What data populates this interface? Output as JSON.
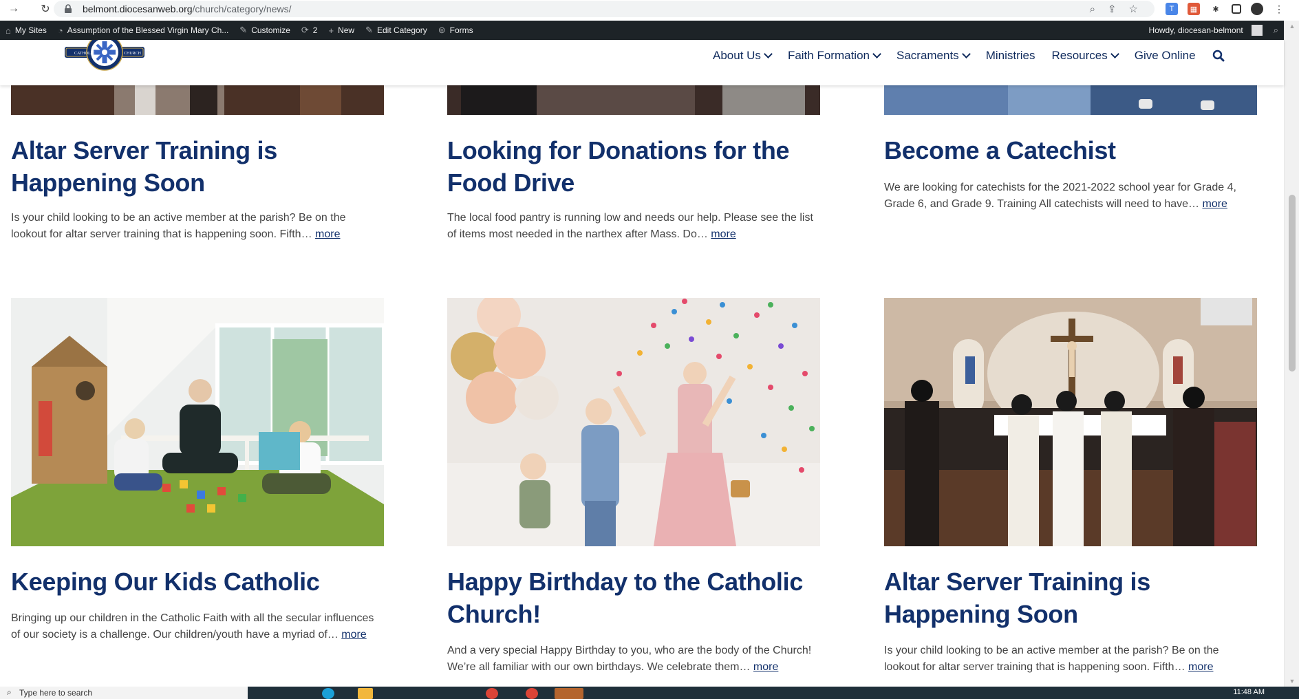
{
  "browser": {
    "url_host": "belmont.diocesanweb.org",
    "url_path": "/church/category/news/"
  },
  "admin_bar": {
    "my_sites": "My Sites",
    "site_name": "Assumption of the Blessed Virgin Mary Ch...",
    "customize": "Customize",
    "comments_count": "2",
    "new": "New",
    "edit_category": "Edit Category",
    "forms": "Forms",
    "howdy": "Howdy, diocesan-belmont"
  },
  "logo": {
    "left_text": "CATHOLIC",
    "right_text": "CHURCH"
  },
  "nav": {
    "about": "About Us",
    "faith_formation": "Faith Formation",
    "sacraments": "Sacraments",
    "ministries": "Ministries",
    "resources": "Resources",
    "give_online": "Give Online"
  },
  "posts": [
    {
      "title": "Altar Server Training is Happening Soon",
      "excerpt": "Is your child looking to be an active member at the parish? Be on the lookout for altar server training that is happening soon. Fifth…",
      "more": "more"
    },
    {
      "title": "Looking for Donations for the Food Drive",
      "excerpt": "The local food pantry is running low and needs our help. Please see the list of items most needed in the narthex after Mass. Do…",
      "more": "more"
    },
    {
      "title": "Become a Catechist",
      "excerpt": "We are looking for catechists for the 2021-2022 school year for Grade 4, Grade 6, and Grade 9. Training All catechists will need to have…",
      "more": "more"
    },
    {
      "title": "Keeping Our Kids Catholic",
      "excerpt": "Bringing up our children in the Catholic Faith with all the secular influences of our society is a challenge. Our children/youth have a myriad of…",
      "more": "more"
    },
    {
      "title": "Happy Birthday to the Catholic Church!",
      "excerpt": "And a very special Happy Birthday to you, who are the body of the Church! We’re all familiar with our own birthdays. We celebrate them…",
      "more": "more"
    },
    {
      "title": "Altar Server Training is Happening Soon",
      "excerpt": "Is your child looking to be an active member at the parish? Be on the lookout for altar server training that is happening soon. Fifth…",
      "more": "more"
    }
  ],
  "taskbar": {
    "search_placeholder": "Type here to search",
    "clock": "11:48 AM"
  },
  "colors": {
    "brand_navy": "#12306b",
    "admin_bar": "#1d2327"
  }
}
